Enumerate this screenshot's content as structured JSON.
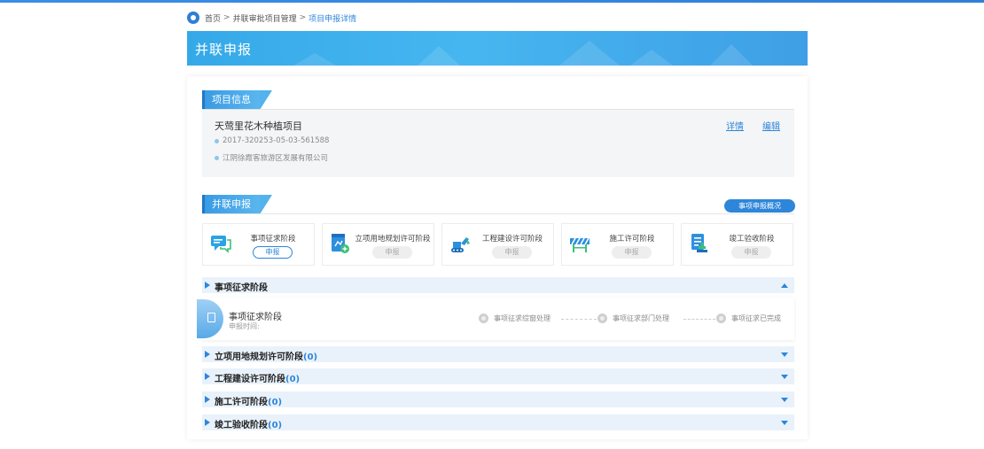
{
  "breadcrumb": {
    "home": "首页",
    "sep1": ">",
    "mid": "并联审批项目管理",
    "sep2": ">",
    "current": "项目申报详情"
  },
  "banner": {
    "title": "并联申报"
  },
  "project_section": {
    "tab": "项目信息"
  },
  "project": {
    "name": "天莺里花木种植项目",
    "code": "2017-320253-05-03-561588",
    "company": "江阴徐霞客旅游区发展有限公司",
    "detail_link": "详情",
    "edit_link": "编辑"
  },
  "apply_section": {
    "tab": "并联申报",
    "overview_button": "事项申报概况"
  },
  "stages": [
    {
      "name": "事项征求阶段",
      "button": "申报",
      "icon": "chat-icon",
      "active": true
    },
    {
      "name": "立项用地规划许可阶段",
      "button": "申报",
      "icon": "planning-permit-icon",
      "active": false
    },
    {
      "name": "工程建设许可阶段",
      "button": "申报",
      "icon": "excavator-icon",
      "active": false
    },
    {
      "name": "施工许可阶段",
      "button": "申报",
      "icon": "barrier-icon",
      "active": false
    },
    {
      "name": "竣工验收阶段",
      "button": "申报",
      "icon": "acceptance-icon",
      "active": false
    }
  ],
  "accordion": [
    {
      "title": "事项征求阶段",
      "count": "",
      "expanded": true
    },
    {
      "title": "立项用地规划许可阶段",
      "count": "(0)",
      "expanded": false
    },
    {
      "title": "工程建设许可阶段",
      "count": "(0)",
      "expanded": false
    },
    {
      "title": "施工许可阶段",
      "count": "(0)",
      "expanded": false
    },
    {
      "title": "竣工验收阶段",
      "count": "(0)",
      "expanded": false
    }
  ],
  "detail": {
    "name": "事项征求阶段",
    "time_label": "申报时间:",
    "steps": [
      "事项征求综窗处理",
      "事项征求部门处理",
      "事项征求已完成"
    ]
  },
  "colors": {
    "accent": "#2d86d9",
    "banner": "#46b6f0",
    "accordion_bg": "#e9f2fb"
  }
}
